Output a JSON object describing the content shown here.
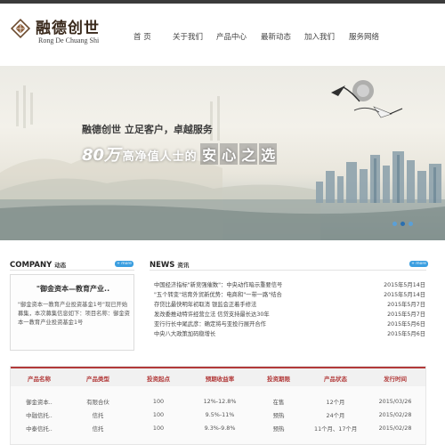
{
  "header": {
    "logo_cn": "融德创世",
    "logo_en": "Rong De Chuang Shi"
  },
  "nav": {
    "items": [
      {
        "label": "首 页"
      },
      {
        "label": "关于我们"
      },
      {
        "label": "产品中心"
      },
      {
        "label": "最新动态"
      },
      {
        "label": "加入我们"
      },
      {
        "label": "服务网络"
      }
    ]
  },
  "banner": {
    "line1": "融德创世  立足客户，卓越服务",
    "num": "80万",
    "mid": "高净值人士的",
    "boxes": [
      "安",
      "心",
      "之",
      "选"
    ],
    "slide_count": 3,
    "active_slide": 1
  },
  "company": {
    "title": "COMPANY",
    "subtitle": "动态",
    "more": "+ more",
    "heading": "\"御金资本—教育产业..",
    "text": "\"御金资本一教育产业投资基金1号\"现已开始募集，本次募集信息如下：项目名称：御金资本一教育产业投资基金1号"
  },
  "news": {
    "title": "NEWS",
    "subtitle": "资讯",
    "more": "+ more",
    "items": [
      {
        "title": "中国经济指标\"新竞强催数\"：中央动作暗示重要信号",
        "date": "2015年5月14日"
      },
      {
        "title": "\"五个转变\"培育外贸新优势：电商和\"一带一路\"结合",
        "date": "2015年5月14日"
      },
      {
        "title": "存贷比最快明年初取消 银监会正着手修法",
        "date": "2015年5月7日"
      },
      {
        "title": "发改委推动特许经营立法 信贷支持最长达30年",
        "date": "2015年5月7日"
      },
      {
        "title": "亚行行长中尾武彦：确定将与亚投行展开合作",
        "date": "2015年5月6日"
      },
      {
        "title": "中央八大政策加码稳增长",
        "date": "2015年5月6日"
      }
    ]
  },
  "products": {
    "headers": [
      "产品名称",
      "产品类型",
      "投资起点",
      "预期收益率",
      "投资期限",
      "产品状态",
      "发行时间"
    ],
    "rows": [
      [
        "御金资本..",
        "有限合伙",
        "100",
        "12%-12.8%",
        "在售",
        "12个月",
        "2015/03/26"
      ],
      [
        "中融信托..",
        "信托",
        "100",
        "9.5%-11%",
        "预热",
        "24个月",
        "2015/02/28"
      ],
      [
        "中泰信托..",
        "信托",
        "100",
        "9.3%-9.8%",
        "预热",
        "11个月、17个月",
        "2015/02/28"
      ]
    ]
  },
  "colors": {
    "accent_blue": "#3a9ee0",
    "table_red": "#b23a3a",
    "topbar": "#3b3b3b"
  }
}
